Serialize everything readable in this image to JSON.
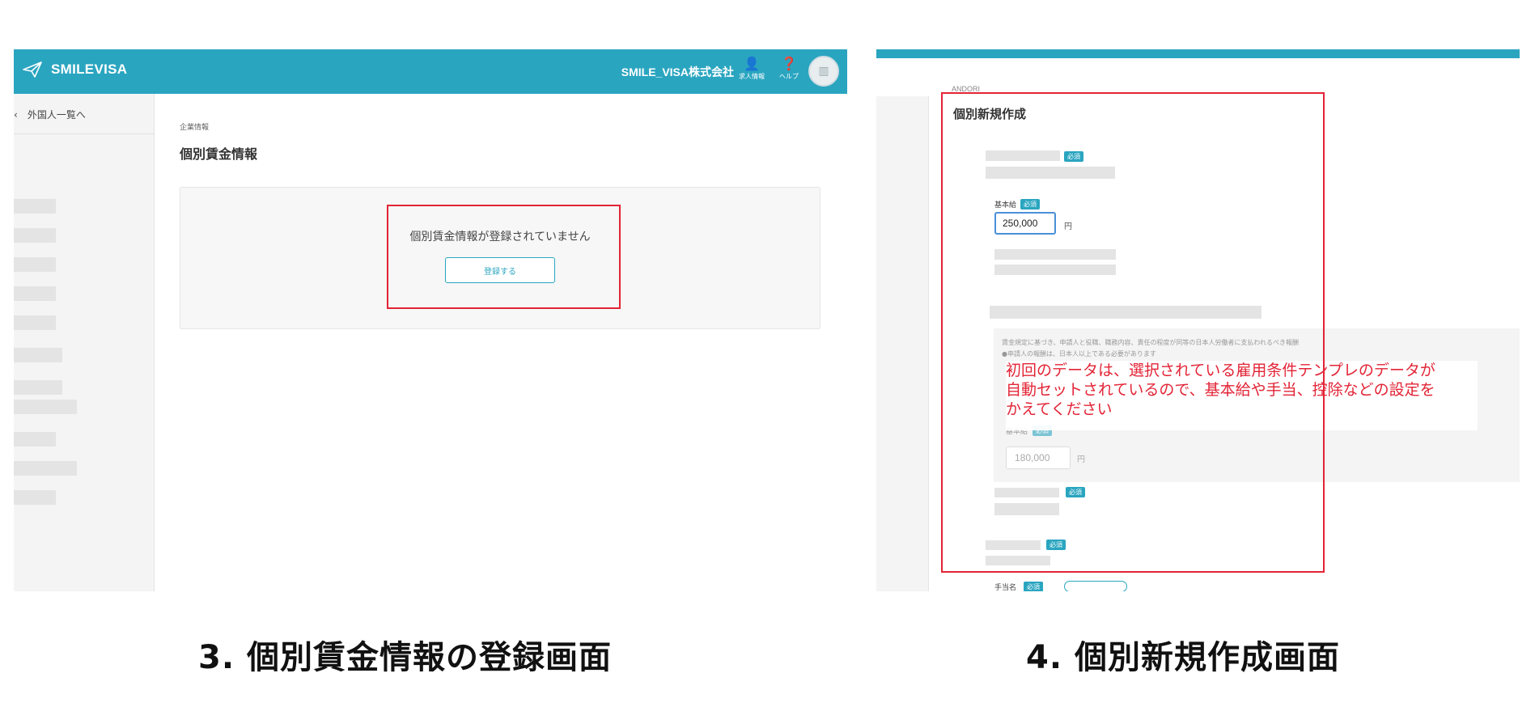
{
  "left_panel": {
    "header": {
      "brand": "SMILEVISA",
      "company": "SMILE_VISA株式会社",
      "icons": [
        {
          "name": "job-info-icon",
          "label": "求人情報"
        },
        {
          "name": "help-icon",
          "label": "ヘルプ"
        }
      ],
      "avatar_icon": "building-icon"
    },
    "sidebar": {
      "back_link": "外国人一覧へ"
    },
    "main": {
      "breadcrumb": "企業情報",
      "title": "個別賃金情報",
      "empty_message": "個別賃金情報が登録されていません",
      "register_button": "登録する"
    }
  },
  "right_panel": {
    "andori": "ANDORI",
    "title": "個別新規作成",
    "required_badge": "必須",
    "base_salary_label": "基本給",
    "base_salary_value": "250,000",
    "yen": "円",
    "template_desc_1": "賃金規定に基づき、申請人と役職、職務内容、責任の程度が同等の日本人労働者に支払われるべき報酬",
    "template_desc_2": "●申請人の報酬は、日本人以上である必要があります",
    "annotation_lines": [
      "初回のデータは、選択されている雇用条件テンプレのデータが",
      "自動セットされているので、基本給や手当、控除などの設定を",
      "かえてください"
    ],
    "template_base_salary_label": "基本給",
    "template_base_salary_value": "180,000",
    "allowance_label": "手当名"
  },
  "captions": {
    "left": "3. 個別賃金情報の登録画面",
    "right": "4. 個別新規作成画面"
  },
  "colors": {
    "accent": "#2aa5c0",
    "annotation_red": "#e22436"
  }
}
